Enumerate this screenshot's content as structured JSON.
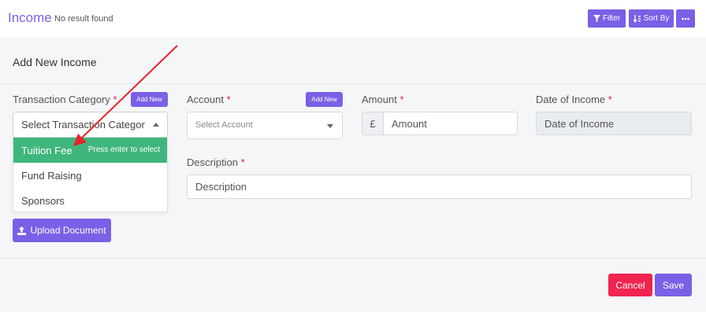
{
  "header": {
    "title": "Income",
    "status": "No result found",
    "filter_label": "Filter",
    "sort_label": "Sort By"
  },
  "form": {
    "title": "Add New Income",
    "transaction_category": {
      "label": "Transaction Category",
      "required_mark": "*",
      "add_new_label": "Add New",
      "placeholder": "Select Transaction Categor",
      "options": [
        "Tuition Fee",
        "Fund Raising",
        "Sponsors"
      ],
      "highlighted_hint": "Press enter to select"
    },
    "account": {
      "label": "Account",
      "required_mark": "*",
      "add_new_label": "Add New",
      "placeholder": "Select Account"
    },
    "amount": {
      "label": "Amount",
      "required_mark": "*",
      "currency_symbol": "£",
      "placeholder": "Amount"
    },
    "date": {
      "label": "Date of Income",
      "required_mark": "*",
      "placeholder": "Date of Income"
    },
    "description": {
      "label": "Description",
      "required_mark": "*",
      "placeholder": "Description"
    },
    "upload_label": "Upload Document",
    "cancel_label": "Cancel",
    "save_label": "Save"
  },
  "colors": {
    "primary": "#7b5fe6",
    "success": "#3fb67c",
    "danger": "#f0244f",
    "annotation_arrow": "#e8232a"
  },
  "icons": [
    "filter-icon",
    "sort-icon",
    "more-icon",
    "upload-icon",
    "caret-up-icon",
    "caret-down-icon"
  ]
}
